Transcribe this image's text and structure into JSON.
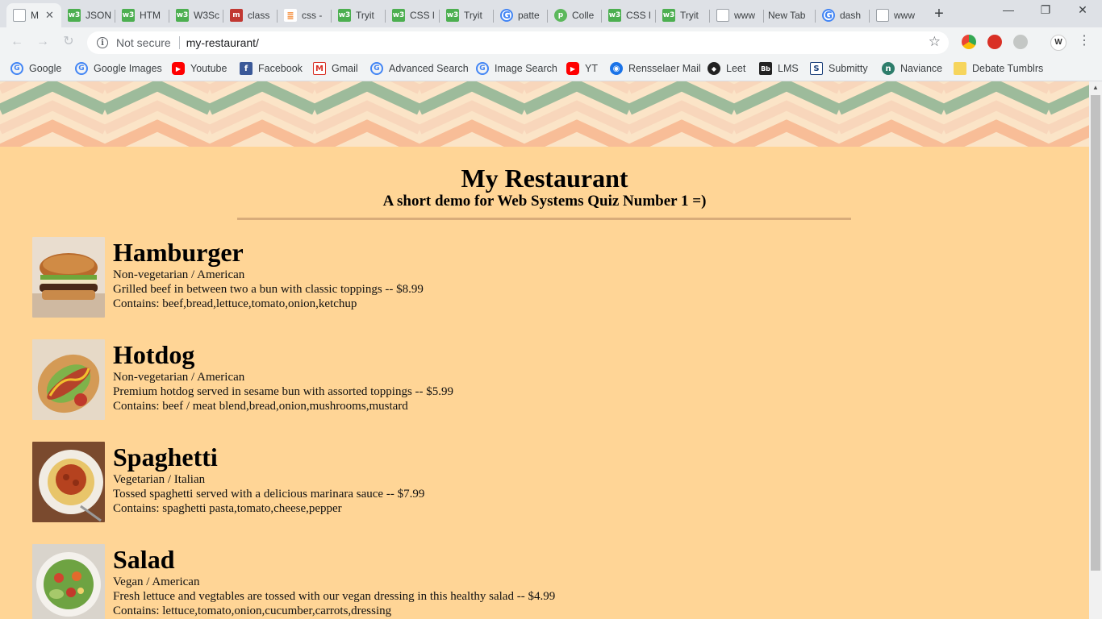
{
  "browser": {
    "tabs": [
      {
        "label": "M",
        "favicon": "document-icon",
        "active": true
      },
      {
        "label": "JSON",
        "favicon": "w3schools-icon"
      },
      {
        "label": "HTM",
        "favicon": "w3schools-icon"
      },
      {
        "label": "W3Sc",
        "favicon": "w3schools-icon"
      },
      {
        "label": "class",
        "favicon": "mdn-icon"
      },
      {
        "label": "css -",
        "favicon": "stackoverflow-icon"
      },
      {
        "label": "Tryit",
        "favicon": "w3schools-icon"
      },
      {
        "label": "CSS l",
        "favicon": "w3schools-icon"
      },
      {
        "label": "Tryit",
        "favicon": "w3schools-icon"
      },
      {
        "label": "patte",
        "favicon": "google-icon"
      },
      {
        "label": "Colle",
        "favicon": "colle-icon"
      },
      {
        "label": "CSS l",
        "favicon": "w3schools-icon"
      },
      {
        "label": "Tryit",
        "favicon": "w3schools-icon"
      },
      {
        "label": "www",
        "favicon": "document-icon"
      },
      {
        "label": "New Tab",
        "favicon": ""
      },
      {
        "label": "dash",
        "favicon": "google-icon"
      },
      {
        "label": "www",
        "favicon": "document-icon"
      }
    ],
    "security_label": "Not secure",
    "url": "my-restaurant/",
    "profile_initial": "W",
    "bookmarks": [
      {
        "label": "Google",
        "icon": "google-icon"
      },
      {
        "label": "Google Images",
        "icon": "google-icon"
      },
      {
        "label": "Youtube",
        "icon": "youtube-icon"
      },
      {
        "label": "Facebook",
        "icon": "facebook-icon"
      },
      {
        "label": "Gmail",
        "icon": "gmail-icon"
      },
      {
        "label": "Advanced Search",
        "icon": "google-icon"
      },
      {
        "label": "Image Search",
        "icon": "google-icon"
      },
      {
        "label": "YT",
        "icon": "youtube-icon"
      },
      {
        "label": "Rensselaer Mail",
        "icon": "globe-icon"
      },
      {
        "label": "Leet",
        "icon": "leet-icon"
      },
      {
        "label": "LMS",
        "icon": "blackboard-icon"
      },
      {
        "label": "Submitty",
        "icon": "submitty-icon"
      },
      {
        "label": "Naviance",
        "icon": "naviance-icon"
      },
      {
        "label": "Debate Tumblrs",
        "icon": "folder-icon"
      }
    ]
  },
  "page": {
    "title": "My Restaurant",
    "subtitle": "A short demo for Web Systems Quiz Number 1 =)",
    "colors": {
      "background": "#ffd596",
      "rule": "#d8ac7a",
      "chevron_green": "#9dbb9b",
      "chevron_peach": "#f8bd97"
    },
    "menu": [
      {
        "name": "Hamburger",
        "category": "Non-vegetarian / American",
        "description": "Grilled beef in between two a bun with classic toppings -- $8.99",
        "contains": "Contains: beef,bread,lettuce,tomato,onion,ketchup",
        "image": "hamburger-photo"
      },
      {
        "name": "Hotdog",
        "category": "Non-vegetarian / American",
        "description": "Premium hotdog served in sesame bun with assorted toppings -- $5.99",
        "contains": "Contains: beef / meat blend,bread,onion,mushrooms,mustard",
        "image": "hotdog-photo"
      },
      {
        "name": "Spaghetti",
        "category": "Vegetarian / Italian",
        "description": "Tossed spaghetti served with a delicious marinara sauce -- $7.99",
        "contains": "Contains: spaghetti pasta,tomato,cheese,pepper",
        "image": "spaghetti-photo"
      },
      {
        "name": "Salad",
        "category": "Vegan / American",
        "description": "Fresh lettuce and vegtables are tossed with our vegan dressing in this healthy salad -- $4.99",
        "contains": "Contains: lettuce,tomato,onion,cucumber,carrots,dressing",
        "image": "salad-photo"
      }
    ]
  }
}
